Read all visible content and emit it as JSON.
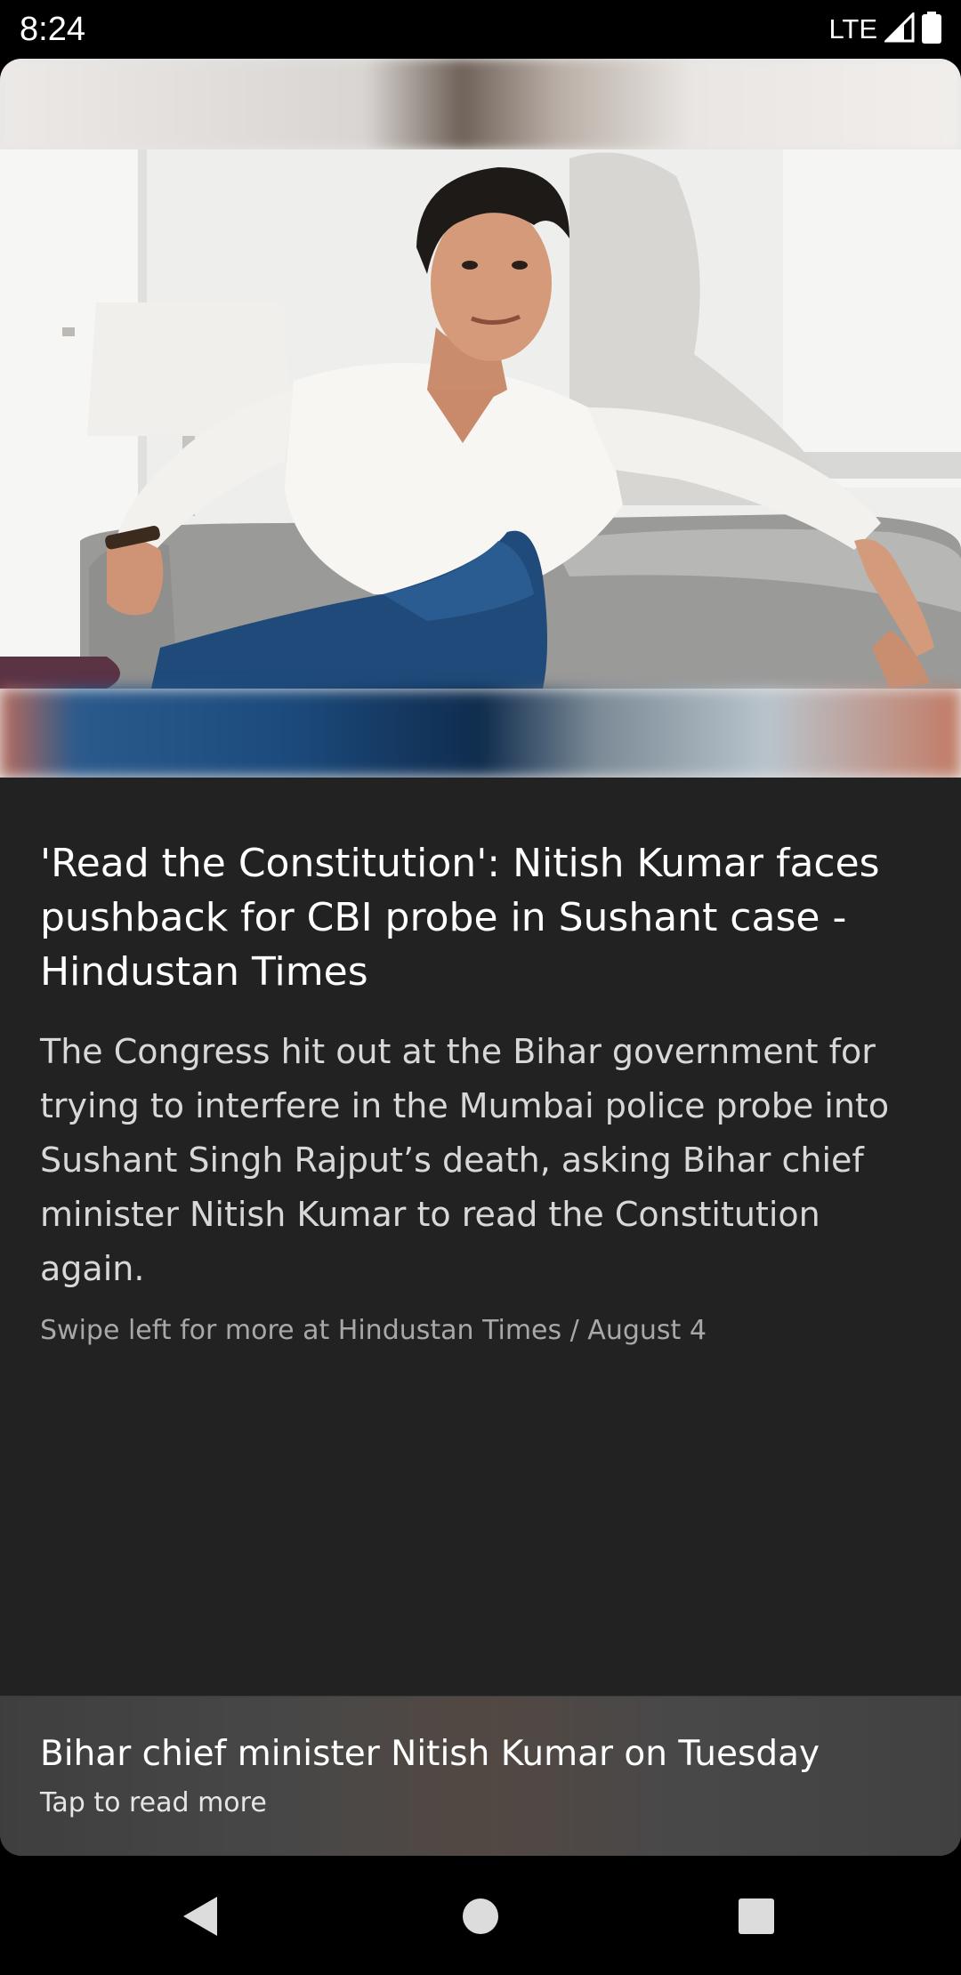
{
  "status_bar": {
    "time": "8:24",
    "network": "LTE",
    "icons": [
      "signal-icon",
      "battery-icon"
    ]
  },
  "article": {
    "image": "photo of a man in a white shirt and blue trousers seated on a grey sofa",
    "title": "'Read the Constitution': Nitish Kumar faces pushback for CBI probe in Sushant case - Hindustan Times",
    "summary": "The Congress hit out at the Bihar government for trying to interfere in the Mumbai police probe into Sushant Singh Rajput’s death, asking Bihar chief minister Nitish Kumar to read the Constitution again.",
    "meta": "Swipe left for more at Hindustan Times / August 4"
  },
  "teaser": {
    "headline": "Bihar chief minister Nitish Kumar on Tuesday",
    "cta": "Tap to read more"
  },
  "nav_bar": {
    "icons": [
      "back-icon",
      "home-icon",
      "recents-icon"
    ]
  },
  "colors": {
    "card_background": "#222222",
    "screen_background": "#000000",
    "text_primary": "#ffffff",
    "text_secondary": "#a8a8a8"
  }
}
